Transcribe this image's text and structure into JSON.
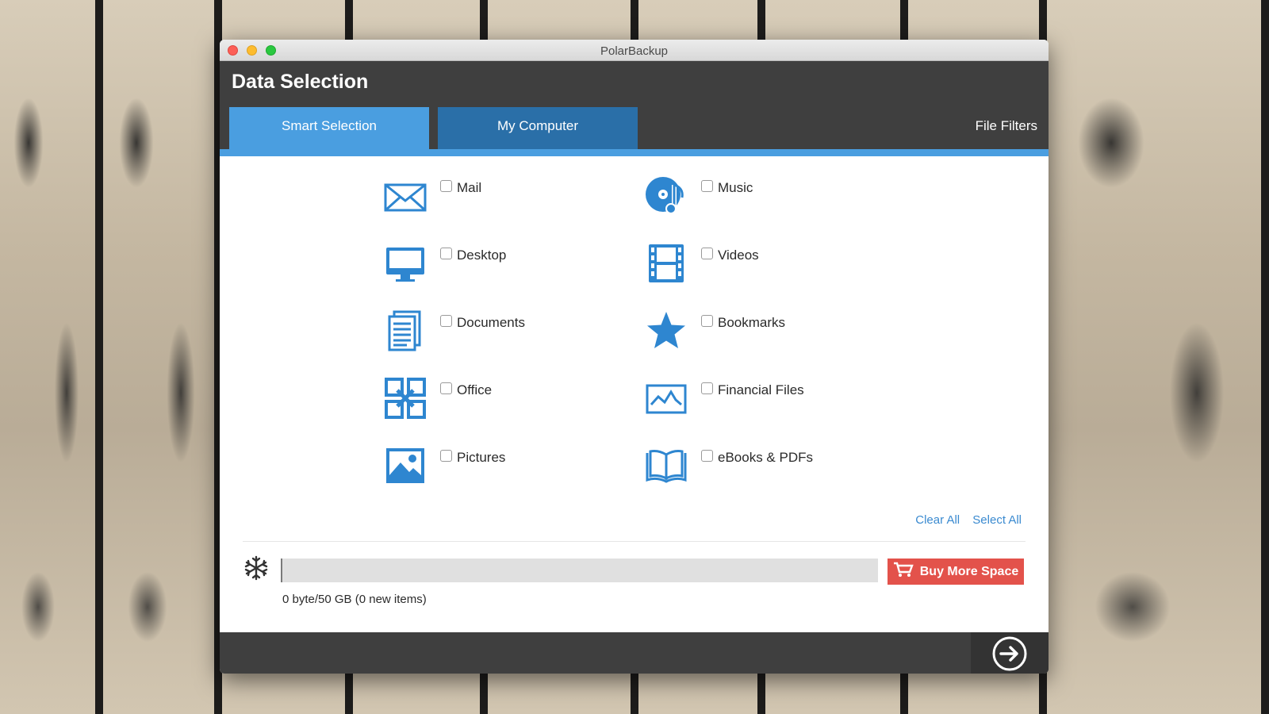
{
  "window": {
    "title": "PolarBackup"
  },
  "header": {
    "title": "Data Selection",
    "tabs": [
      {
        "label": "Smart Selection",
        "active": true
      },
      {
        "label": "My Computer",
        "active": false
      }
    ],
    "file_filters": "File Filters"
  },
  "categories": {
    "left": [
      {
        "label": "Mail",
        "icon": "mail-icon",
        "checked": false
      },
      {
        "label": "Desktop",
        "icon": "monitor-icon",
        "checked": false
      },
      {
        "label": "Documents",
        "icon": "documents-icon",
        "checked": false
      },
      {
        "label": "Office",
        "icon": "office-icon",
        "checked": false
      },
      {
        "label": "Pictures",
        "icon": "picture-icon",
        "checked": false
      }
    ],
    "right": [
      {
        "label": "Music",
        "icon": "music-icon",
        "checked": false
      },
      {
        "label": "Videos",
        "icon": "film-icon",
        "checked": false
      },
      {
        "label": "Bookmarks",
        "icon": "star-icon",
        "checked": false
      },
      {
        "label": "Financial Files",
        "icon": "chart-icon",
        "checked": false
      },
      {
        "label": "eBooks & PDFs",
        "icon": "book-icon",
        "checked": false
      }
    ]
  },
  "actions": {
    "clear_all": "Clear All",
    "select_all": "Select All"
  },
  "storage": {
    "usage_text": "0 byte/50 GB (0 new items)",
    "used_fraction": 0,
    "buy_label": "Buy More Space"
  },
  "colors": {
    "accent": "#4a9ee0",
    "tab_secondary": "#2a6fa8",
    "header_bg": "#3f3f3f",
    "buy_button": "#e3524b",
    "icon": "#2e86d0"
  }
}
